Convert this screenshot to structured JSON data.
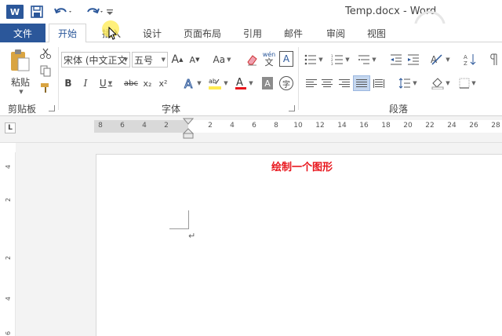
{
  "titlebar": {
    "app_icon": "W",
    "document_title": "Temp.docx - Word"
  },
  "tabs": [
    "文件",
    "开始",
    "插入",
    "设计",
    "页面布局",
    "引用",
    "邮件",
    "审阅",
    "视图"
  ],
  "active_tab": "开始",
  "ribbon": {
    "clipboard": {
      "paste_label": "粘贴",
      "group_label": "剪贴板"
    },
    "font": {
      "font_name": "宋体 (中文正文",
      "font_size": "五号",
      "bold": "B",
      "italic": "I",
      "underline": "U",
      "strike": "abc",
      "subscript": "x₂",
      "superscript": "x²",
      "grow": "A",
      "shrink": "A",
      "change_case": "Aa",
      "phonetic_top": "wén",
      "phonetic_bottom": "文",
      "border_char": "A",
      "enclose_char": "字",
      "group_label": "字体"
    },
    "paragraph": {
      "group_label": "段落"
    }
  },
  "ruler": {
    "tab_selector": "L",
    "h_labels": [
      "8",
      "6",
      "4",
      "2",
      "",
      "2",
      "4",
      "6",
      "8",
      "10",
      "12",
      "14",
      "16",
      "18",
      "20",
      "22",
      "24",
      "26",
      "28"
    ],
    "v_labels": [
      "4",
      "2",
      "",
      "2",
      "4",
      "6"
    ]
  },
  "document": {
    "annotation": "绘制一个图形",
    "paragraph_mark": "↵"
  },
  "colors": {
    "brand_blue": "#2b579a",
    "annotation_red": "#e8141b",
    "highlight_yellow": "#ffeb50",
    "font_color_red": "#e8141b"
  },
  "icons": [
    "word-app-icon",
    "save-icon",
    "undo-icon",
    "redo-icon",
    "cut-icon",
    "copy-icon",
    "format-painter-icon",
    "clear-format-icon",
    "text-effects-icon",
    "highlight-icon",
    "font-color-icon",
    "bullets-icon",
    "numbering-icon",
    "multilevel-list-icon",
    "decrease-indent-icon",
    "increase-indent-icon",
    "sort-icon",
    "show-marks-icon",
    "align-left-icon",
    "center-icon",
    "align-right-icon",
    "justify-icon",
    "distributed-icon",
    "line-spacing-icon",
    "shading-icon",
    "borders-icon"
  ]
}
